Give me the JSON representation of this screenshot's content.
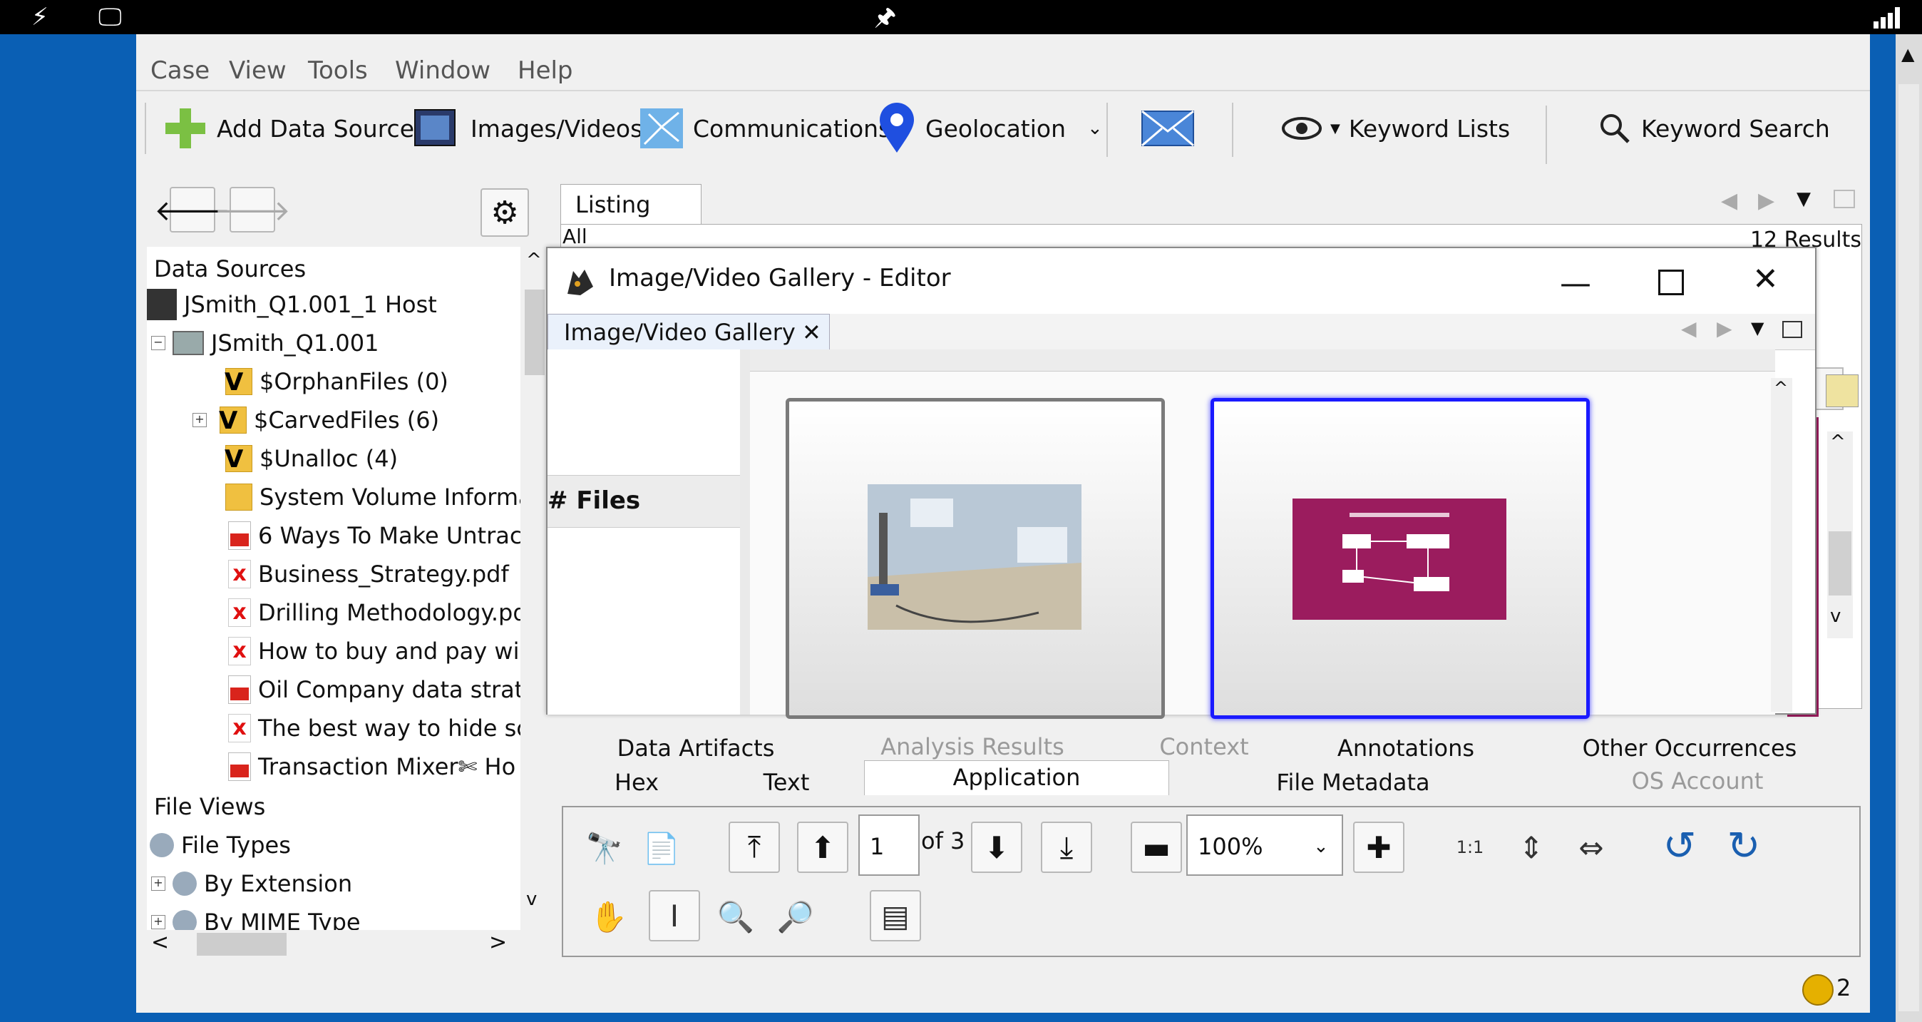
{
  "system_bar": {
    "left_icons": [
      "lightning-icon",
      "monitor-icon"
    ],
    "center_icon": "pin-icon",
    "right_icon": "signal-icon"
  },
  "menu": [
    "Case",
    "View",
    "Tools",
    "Window",
    "Help"
  ],
  "toolbar": {
    "add_data_source": "Add Data Source",
    "images_videos": "Images/Videos",
    "communications": "Communications",
    "geolocation": "Geolocation",
    "keyword_lists": "Keyword Lists",
    "keyword_search": "Keyword Search"
  },
  "tree": {
    "data_sources": "Data Sources",
    "host": "JSmith_Q1.001_1 Host",
    "image": "JSmith_Q1.001",
    "items": [
      "$OrphanFiles (0)",
      "$CarvedFiles (6)",
      "$Unalloc (4)",
      "System Volume Informa",
      "6 Ways To Make Untrac",
      "Business_Strategy.pdf",
      "Drilling Methodology.pd",
      "How to buy and pay wi",
      "Oil Company data strat",
      "The best way to hide sc",
      "Transaction Mixer✄ Ho"
    ],
    "file_views": "File Views",
    "file_types": "File Types",
    "by_extension": "By Extension",
    "by_mime_type": "By MIME Type"
  },
  "listing": {
    "tab": "Listing",
    "filter": "All",
    "results": "12  Results"
  },
  "dialog": {
    "title": "Image/Video Gallery - Editor",
    "tab": "Image/Video Gallery",
    "files_header": "# Files",
    "thumb2_color": "#9b1c5e"
  },
  "viewer_tabs": {
    "row1": [
      "Data Artifacts",
      "Analysis Results",
      "Context",
      "Annotations",
      "Other Occurrences"
    ],
    "row2": [
      "Hex",
      "Text",
      "Application",
      "File Metadata",
      "OS Account"
    ]
  },
  "viewer": {
    "page": "1",
    "of_pages": "of 3",
    "zoom": "100%"
  },
  "status": {
    "notification_count": "2"
  },
  "colors": {
    "accent_blue": "#0a5fb4",
    "selection_border": "#1a1aff"
  }
}
